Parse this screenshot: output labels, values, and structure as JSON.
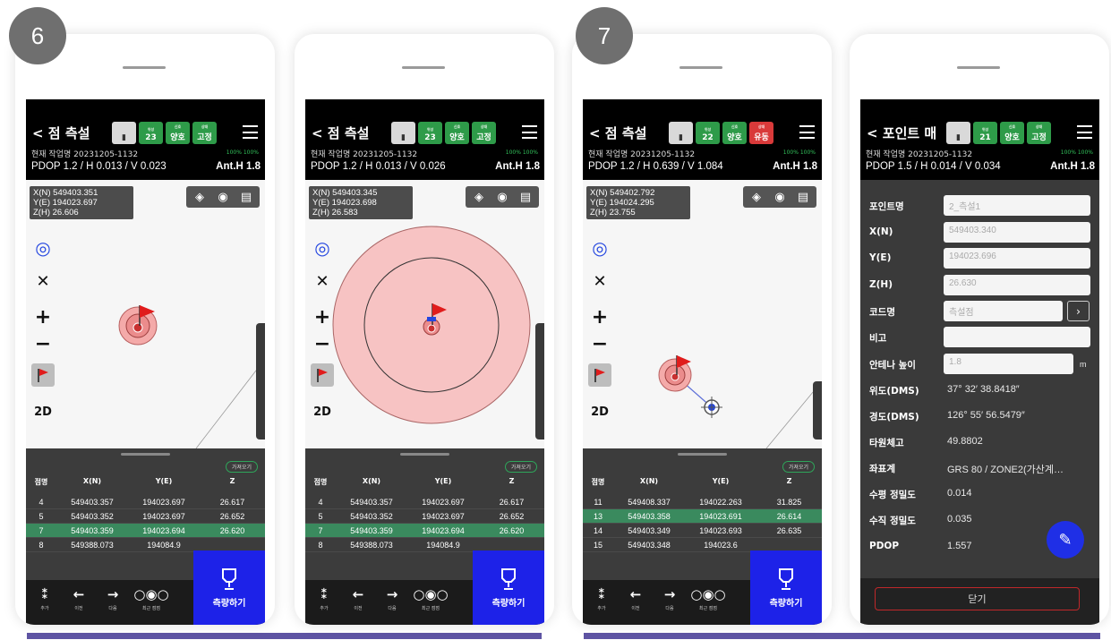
{
  "steps": [
    "6",
    "7"
  ],
  "common": {
    "back_title": "점 측설",
    "job": "현재 작업명 20231205-1132",
    "battery": "100%  100%",
    "hide_label": "가져오기",
    "nav": {
      "add": "추가",
      "prev": "이전",
      "next": "다음",
      "recent": "최근 점점"
    },
    "measure_label": "측량하기",
    "table_headers": [
      "점명",
      "X(N)",
      "Y(E)",
      "Z"
    ]
  },
  "screens": [
    {
      "badges": [
        {
          "label": "23",
          "cap": "위성"
        },
        {
          "label": "양호",
          "cap": "신호"
        },
        {
          "label": "고정",
          "cap": "상태"
        }
      ],
      "pdop": "PDOP 1.2 / H 0.013 / V 0.023",
      "anth": "Ant.H 1.8",
      "coords": [
        "X(N) 549403.351",
        "Y(E) 194023.697",
        "Z(H) 26.606"
      ],
      "rows": [
        [
          "4",
          "549403.357",
          "194023.697",
          "26.617"
        ],
        [
          "5",
          "549403.352",
          "194023.697",
          "26.652"
        ],
        [
          "7",
          "549403.359",
          "194023.694",
          "26.620"
        ],
        [
          "8",
          "549388.073",
          "194084.9",
          ""
        ]
      ],
      "selected_row": 2
    },
    {
      "badges": [
        {
          "label": "23",
          "cap": "위성"
        },
        {
          "label": "양호",
          "cap": "신호"
        },
        {
          "label": "고정",
          "cap": "상태"
        }
      ],
      "pdop": "PDOP 1.2 / H 0.013 / V 0.026",
      "anth": "Ant.H 1.8",
      "coords": [
        "X(N) 549403.345",
        "Y(E) 194023.698",
        "Z(H) 26.583"
      ],
      "rows": [
        [
          "4",
          "549403.357",
          "194023.697",
          "26.617"
        ],
        [
          "5",
          "549403.352",
          "194023.697",
          "26.652"
        ],
        [
          "7",
          "549403.359",
          "194023.694",
          "26.620"
        ],
        [
          "8",
          "549388.073",
          "194084.9",
          ""
        ]
      ],
      "selected_row": 2
    },
    {
      "badges": [
        {
          "label": "22",
          "cap": "위성"
        },
        {
          "label": "양호",
          "cap": "신호"
        },
        {
          "label": "유동",
          "cap": "상태"
        }
      ],
      "pdop": "PDOP 1.2 / H 0.639 / V 1.084",
      "anth": "Ant.H 1.8",
      "coords": [
        "X(N) 549402.792",
        "Y(E) 194024.295",
        "Z(H) 23.755"
      ],
      "rows": [
        [
          "11",
          "549408.337",
          "194022.263",
          "31.825"
        ],
        [
          "13",
          "549403.358",
          "194023.691",
          "26.614"
        ],
        [
          "14",
          "549403.349",
          "194023.693",
          "26.635"
        ],
        [
          "15",
          "549403.348",
          "194023.6",
          ""
        ]
      ],
      "selected_row": 1
    }
  ],
  "detail": {
    "back_title": "포인트 매",
    "badges": [
      {
        "label": "21",
        "cap": "위성"
      },
      {
        "label": "양호",
        "cap": "신호"
      },
      {
        "label": "고정",
        "cap": "상태"
      }
    ],
    "pdop": "PDOP 1.5 / H 0.014 / V 0.034",
    "anth": "Ant.H 1.8",
    "fields": {
      "point_name": {
        "label": "포인트명",
        "value": "2_측설1"
      },
      "x": {
        "label": "X(N)",
        "value": "549403.340"
      },
      "y": {
        "label": "Y(E)",
        "value": "194023.696"
      },
      "z": {
        "label": "Z(H)",
        "value": "26.630"
      },
      "code": {
        "label": "코드명",
        "value": "측설점"
      },
      "note": {
        "label": "비고",
        "value": ""
      },
      "ant": {
        "label": "안테나 높이",
        "value": "1.8",
        "unit": "m"
      },
      "lat": {
        "label": "위도(DMS)",
        "value": "37° 32′ 38.8418″"
      },
      "lon": {
        "label": "경도(DMS)",
        "value": "126° 55′ 56.5479″"
      },
      "ell": {
        "label": "타원체고",
        "value": "49.8802"
      },
      "crs": {
        "label": "좌표계",
        "value": "GRS 80 / ZONE2(가산계…"
      },
      "hprec": {
        "label": "수평 정밀도",
        "value": "0.014"
      },
      "vprec": {
        "label": "수직 정밀도",
        "value": "0.035"
      },
      "pdopv": {
        "label": "PDOP",
        "value": "1.557"
      }
    },
    "close_label": "닫기"
  },
  "colors": {
    "accent_blue": "#1d22e8",
    "fix_green": "#2e9b49",
    "float_red": "#d93a3a",
    "selected_row": "#3a8a5e",
    "underline": "#5e54a3"
  }
}
